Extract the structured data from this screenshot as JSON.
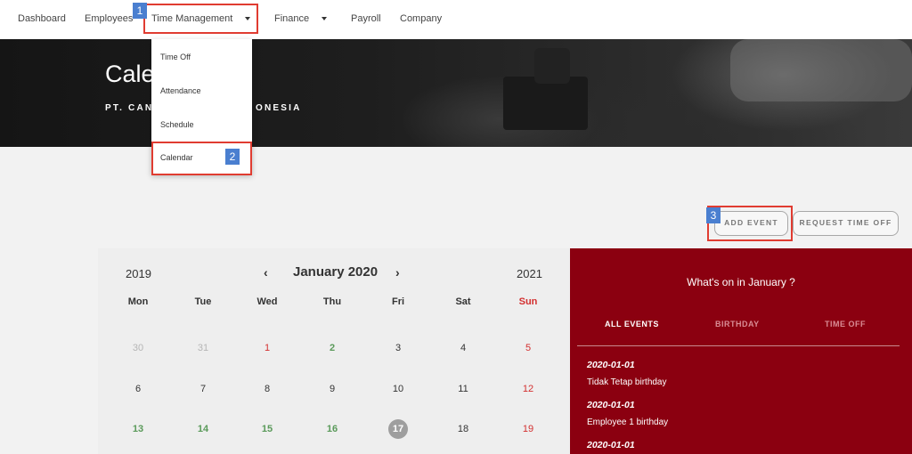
{
  "nav": {
    "items": [
      {
        "label": "Dashboard"
      },
      {
        "label": "Employees"
      },
      {
        "label": "Time Management"
      },
      {
        "label": "Finance"
      },
      {
        "label": "Payroll"
      },
      {
        "label": "Company"
      }
    ]
  },
  "hero": {
    "title": "Cale",
    "subtitle_left": "PT. CAN",
    "subtitle_right": "ONESIA"
  },
  "dropdown": {
    "items": [
      {
        "label": "Time Off"
      },
      {
        "label": "Attendance"
      },
      {
        "label": "Schedule"
      },
      {
        "label": "Calendar"
      }
    ]
  },
  "annotations": {
    "badge1": "1",
    "badge2": "2",
    "badge3": "3",
    "color": "#e03c31",
    "badge_color": "#4a7fd0"
  },
  "buttons": {
    "add_event": "ADD EVENT",
    "request_time_off": "REQUEST TIME OFF"
  },
  "calendar": {
    "prev_year": "2019",
    "next_year": "2021",
    "month_label": "January 2020",
    "prev_arrow": "‹",
    "next_arrow": "›",
    "weekdays": [
      "Mon",
      "Tue",
      "Wed",
      "Thu",
      "Fri",
      "Sat",
      "Sun"
    ],
    "weeks": [
      [
        {
          "d": "30",
          "s": "muted"
        },
        {
          "d": "31",
          "s": "muted"
        },
        {
          "d": "1",
          "s": "red"
        },
        {
          "d": "2",
          "s": "green"
        },
        {
          "d": "3",
          "s": ""
        },
        {
          "d": "4",
          "s": ""
        },
        {
          "d": "5",
          "s": "red"
        }
      ],
      [
        {
          "d": "6",
          "s": ""
        },
        {
          "d": "7",
          "s": ""
        },
        {
          "d": "8",
          "s": ""
        },
        {
          "d": "9",
          "s": ""
        },
        {
          "d": "10",
          "s": ""
        },
        {
          "d": "11",
          "s": ""
        },
        {
          "d": "12",
          "s": "red"
        }
      ],
      [
        {
          "d": "13",
          "s": "green"
        },
        {
          "d": "14",
          "s": "green"
        },
        {
          "d": "15",
          "s": "green"
        },
        {
          "d": "16",
          "s": "green"
        },
        {
          "d": "17",
          "s": "today"
        },
        {
          "d": "18",
          "s": ""
        },
        {
          "d": "19",
          "s": "red"
        }
      ]
    ],
    "colors": {
      "background": "#eeeeee",
      "holiday": "#d32f2f",
      "event": "#5a9a5a",
      "today": "#9e9e9e"
    }
  },
  "events": {
    "title": "What's on in January ?",
    "tabs": [
      "ALL EVENTS",
      "BIRTHDAY",
      "TIME OFF"
    ],
    "list": [
      {
        "date": "2020-01-01",
        "desc": "Tidak Tetap birthday"
      },
      {
        "date": "2020-01-01",
        "desc": "Employee 1 birthday"
      },
      {
        "date": "2020-01-01",
        "desc": ""
      }
    ],
    "colors": {
      "background": "#8b0010"
    }
  }
}
